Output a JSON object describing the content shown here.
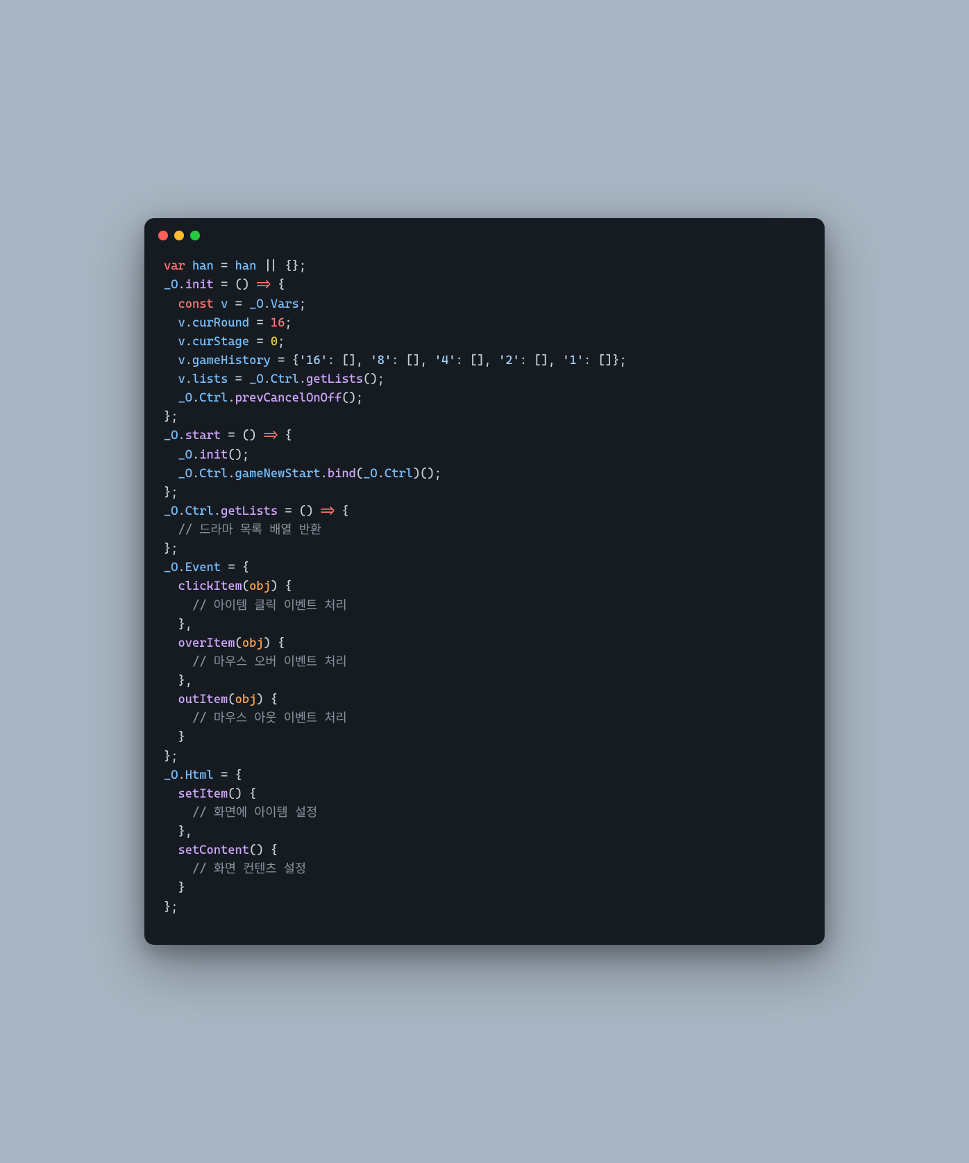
{
  "code": {
    "tokens": [
      [
        [
          "kw",
          "var"
        ],
        [
          "pn",
          " "
        ],
        [
          "id",
          "han"
        ],
        [
          "pn",
          " = "
        ],
        [
          "id",
          "han"
        ],
        [
          "pn",
          " || {};"
        ]
      ],
      [
        [
          "id",
          "_O"
        ],
        [
          "pn",
          "."
        ],
        [
          "fn",
          "init"
        ],
        [
          "pn",
          " = () "
        ],
        [
          "op",
          "=>"
        ],
        [
          "pn",
          " {"
        ]
      ],
      [
        [
          "pn",
          "  "
        ],
        [
          "kw",
          "const"
        ],
        [
          "pn",
          " "
        ],
        [
          "id",
          "v"
        ],
        [
          "pn",
          " = "
        ],
        [
          "id",
          "_O"
        ],
        [
          "pn",
          "."
        ],
        [
          "prop",
          "Vars"
        ],
        [
          "pn",
          ";"
        ]
      ],
      [
        [
          "pn",
          "  "
        ],
        [
          "id",
          "v"
        ],
        [
          "pn",
          "."
        ],
        [
          "prop",
          "curRound"
        ],
        [
          "pn",
          " = "
        ],
        [
          "num2",
          "16"
        ],
        [
          "pn",
          ";"
        ]
      ],
      [
        [
          "pn",
          "  "
        ],
        [
          "id",
          "v"
        ],
        [
          "pn",
          "."
        ],
        [
          "prop",
          "curStage"
        ],
        [
          "pn",
          " = "
        ],
        [
          "num",
          "0"
        ],
        [
          "pn",
          ";"
        ]
      ],
      [
        [
          "pn",
          "  "
        ],
        [
          "id",
          "v"
        ],
        [
          "pn",
          "."
        ],
        [
          "prop",
          "gameHistory"
        ],
        [
          "pn",
          " = {"
        ],
        [
          "str",
          "'16'"
        ],
        [
          "pn",
          ": [], "
        ],
        [
          "str",
          "'8'"
        ],
        [
          "pn",
          ": [], "
        ],
        [
          "str",
          "'4'"
        ],
        [
          "pn",
          ": [], "
        ],
        [
          "str",
          "'2'"
        ],
        [
          "pn",
          ": [], "
        ],
        [
          "str",
          "'1'"
        ],
        [
          "pn",
          ": []};"
        ]
      ],
      [
        [
          "pn",
          "  "
        ],
        [
          "id",
          "v"
        ],
        [
          "pn",
          "."
        ],
        [
          "prop",
          "lists"
        ],
        [
          "pn",
          " = "
        ],
        [
          "id",
          "_O"
        ],
        [
          "pn",
          "."
        ],
        [
          "prop",
          "Ctrl"
        ],
        [
          "pn",
          "."
        ],
        [
          "fn",
          "getLists"
        ],
        [
          "pn",
          "();"
        ]
      ],
      [
        [
          "pn",
          "  "
        ],
        [
          "id",
          "_O"
        ],
        [
          "pn",
          "."
        ],
        [
          "prop",
          "Ctrl"
        ],
        [
          "pn",
          "."
        ],
        [
          "fn",
          "prevCancelOnOff"
        ],
        [
          "pn",
          "();"
        ]
      ],
      [
        [
          "pn",
          "};"
        ]
      ],
      [
        [
          "id",
          "_O"
        ],
        [
          "pn",
          "."
        ],
        [
          "fn",
          "start"
        ],
        [
          "pn",
          " = () "
        ],
        [
          "op",
          "=>"
        ],
        [
          "pn",
          " {"
        ]
      ],
      [
        [
          "pn",
          "  "
        ],
        [
          "id",
          "_O"
        ],
        [
          "pn",
          "."
        ],
        [
          "fn",
          "init"
        ],
        [
          "pn",
          "();"
        ]
      ],
      [
        [
          "pn",
          "  "
        ],
        [
          "id",
          "_O"
        ],
        [
          "pn",
          "."
        ],
        [
          "prop",
          "Ctrl"
        ],
        [
          "pn",
          "."
        ],
        [
          "prop",
          "gameNewStart"
        ],
        [
          "pn",
          "."
        ],
        [
          "fn",
          "bind"
        ],
        [
          "pn",
          "("
        ],
        [
          "id",
          "_O"
        ],
        [
          "pn",
          "."
        ],
        [
          "prop",
          "Ctrl"
        ],
        [
          "pn",
          ")();"
        ]
      ],
      [
        [
          "pn",
          "};"
        ]
      ],
      [
        [
          "id",
          "_O"
        ],
        [
          "pn",
          "."
        ],
        [
          "prop",
          "Ctrl"
        ],
        [
          "pn",
          "."
        ],
        [
          "fn",
          "getLists"
        ],
        [
          "pn",
          " = () "
        ],
        [
          "op",
          "=>"
        ],
        [
          "pn",
          " {"
        ]
      ],
      [
        [
          "pn",
          "  "
        ],
        [
          "cm",
          "// 드라마 목록 배열 반환"
        ]
      ],
      [
        [
          "pn",
          "};"
        ]
      ],
      [
        [
          "id",
          "_O"
        ],
        [
          "pn",
          "."
        ],
        [
          "prop",
          "Event"
        ],
        [
          "pn",
          " = {"
        ]
      ],
      [
        [
          "pn",
          "  "
        ],
        [
          "fn",
          "clickItem"
        ],
        [
          "pn",
          "("
        ],
        [
          "obj",
          "obj"
        ],
        [
          "pn",
          ") {"
        ]
      ],
      [
        [
          "pn",
          "    "
        ],
        [
          "cm",
          "// 아이템 클릭 이벤트 처리"
        ]
      ],
      [
        [
          "pn",
          "  },"
        ]
      ],
      [
        [
          "pn",
          "  "
        ],
        [
          "fn",
          "overItem"
        ],
        [
          "pn",
          "("
        ],
        [
          "obj",
          "obj"
        ],
        [
          "pn",
          ") {"
        ]
      ],
      [
        [
          "pn",
          "    "
        ],
        [
          "cm",
          "// 마우스 오버 이벤트 처리"
        ]
      ],
      [
        [
          "pn",
          "  },"
        ]
      ],
      [
        [
          "pn",
          "  "
        ],
        [
          "fn",
          "outItem"
        ],
        [
          "pn",
          "("
        ],
        [
          "obj",
          "obj"
        ],
        [
          "pn",
          ") {"
        ]
      ],
      [
        [
          "pn",
          "    "
        ],
        [
          "cm",
          "// 마우스 아웃 이벤트 처리"
        ]
      ],
      [
        [
          "pn",
          "  }"
        ]
      ],
      [
        [
          "pn",
          "};"
        ]
      ],
      [
        [
          "id",
          "_O"
        ],
        [
          "pn",
          "."
        ],
        [
          "prop",
          "Html"
        ],
        [
          "pn",
          " = {"
        ]
      ],
      [
        [
          "pn",
          "  "
        ],
        [
          "fn",
          "setItem"
        ],
        [
          "pn",
          "() {"
        ]
      ],
      [
        [
          "pn",
          "    "
        ],
        [
          "cm",
          "// 화면에 아이템 설정"
        ]
      ],
      [
        [
          "pn",
          "  },"
        ]
      ],
      [
        [
          "pn",
          "  "
        ],
        [
          "fn",
          "setContent"
        ],
        [
          "pn",
          "() {"
        ]
      ],
      [
        [
          "pn",
          "    "
        ],
        [
          "cm",
          "// 화면 컨텐츠 설정"
        ]
      ],
      [
        [
          "pn",
          "  }"
        ]
      ],
      [
        [
          "pn",
          "};"
        ]
      ]
    ]
  }
}
